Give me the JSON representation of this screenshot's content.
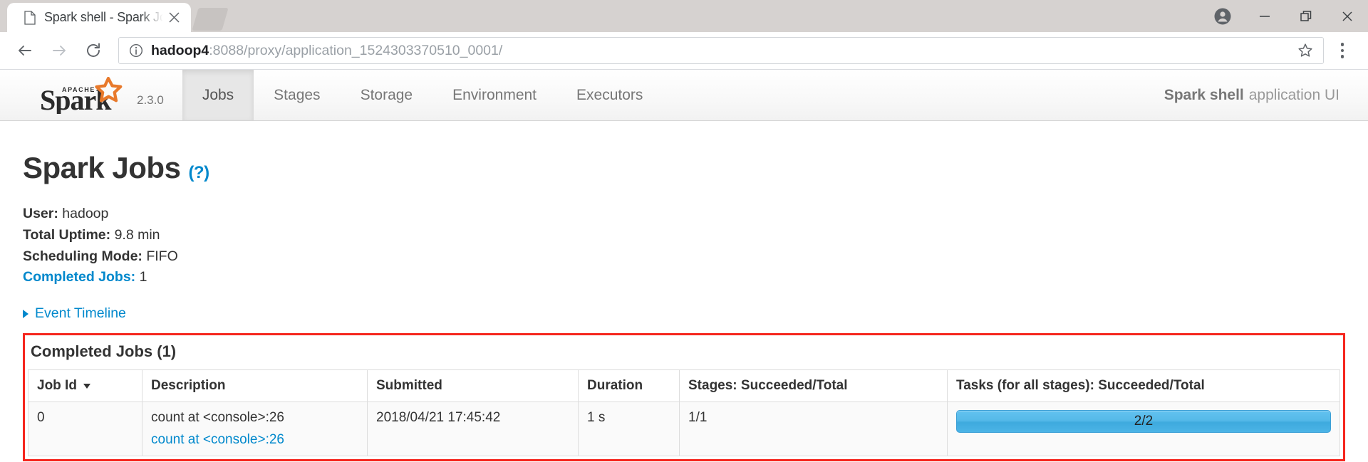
{
  "browser": {
    "tab": {
      "title": "Spark shell - Spark Jobs",
      "favicon_icon": "page-icon",
      "close_icon": "close-icon"
    },
    "new_tab_icon": "new-tab-button",
    "window": {
      "profile_icon": "profile-avatar-icon",
      "minimize_icon": "minimize-icon",
      "restore_icon": "restore-icon",
      "close_icon": "window-close-icon"
    },
    "toolbar": {
      "back_icon": "back-arrow-icon",
      "forward_icon": "forward-arrow-icon",
      "reload_icon": "reload-icon",
      "site_info_icon": "info-circle-icon",
      "url_host": "hadoop4",
      "url_path": ":8088/proxy/application_1524303370510_0001/",
      "url_full": "hadoop4:8088/proxy/application_1524303370510_0001/",
      "bookmark_icon": "star-icon",
      "menu_icon": "three-dots-menu-icon"
    }
  },
  "spark": {
    "brand": {
      "logo_icon": "apache-spark-logo",
      "logo_text": "Spark",
      "logo_superscript": "APACHE",
      "version": "2.3.0"
    },
    "nav": [
      {
        "label": "Jobs",
        "active": true
      },
      {
        "label": "Stages",
        "active": false
      },
      {
        "label": "Storage",
        "active": false
      },
      {
        "label": "Environment",
        "active": false
      },
      {
        "label": "Executors",
        "active": false
      }
    ],
    "app_ui": {
      "name": "Spark shell",
      "suffix": "application UI"
    },
    "page_title": "Spark Jobs",
    "page_title_help": "(?)",
    "summary": [
      {
        "label": "User:",
        "value": "hadoop",
        "link": false
      },
      {
        "label": "Total Uptime:",
        "value": "9.8 min",
        "link": false
      },
      {
        "label": "Scheduling Mode:",
        "value": "FIFO",
        "link": false
      },
      {
        "label": "Completed Jobs:",
        "value": "1",
        "link": true
      }
    ],
    "event_timeline": {
      "label": "Event Timeline",
      "expanded": false,
      "caret_icon": "caret-right-icon"
    },
    "completed_jobs_heading": "Completed Jobs (1)",
    "table": {
      "columns": [
        {
          "label": "Job Id",
          "sorted": true,
          "sort_icon": "caret-down-icon"
        },
        {
          "label": "Description",
          "sorted": false
        },
        {
          "label": "Submitted",
          "sorted": false
        },
        {
          "label": "Duration",
          "sorted": false
        },
        {
          "label": "Stages: Succeeded/Total",
          "sorted": false
        },
        {
          "label": "Tasks (for all stages): Succeeded/Total",
          "sorted": false
        }
      ],
      "rows": [
        {
          "job_id": "0",
          "description": "count at <console>:26",
          "description_link": "count at <console>:26",
          "submitted": "2018/04/21 17:45:42",
          "duration": "1 s",
          "stages": "1/1",
          "tasks_label": "2/2",
          "tasks_percent": 100
        }
      ]
    },
    "colors": {
      "link": "#0088cc",
      "highlight_border": "#f5261e",
      "progress_fill": "#4bb4e6",
      "logo_accent": "#e8792b"
    }
  }
}
